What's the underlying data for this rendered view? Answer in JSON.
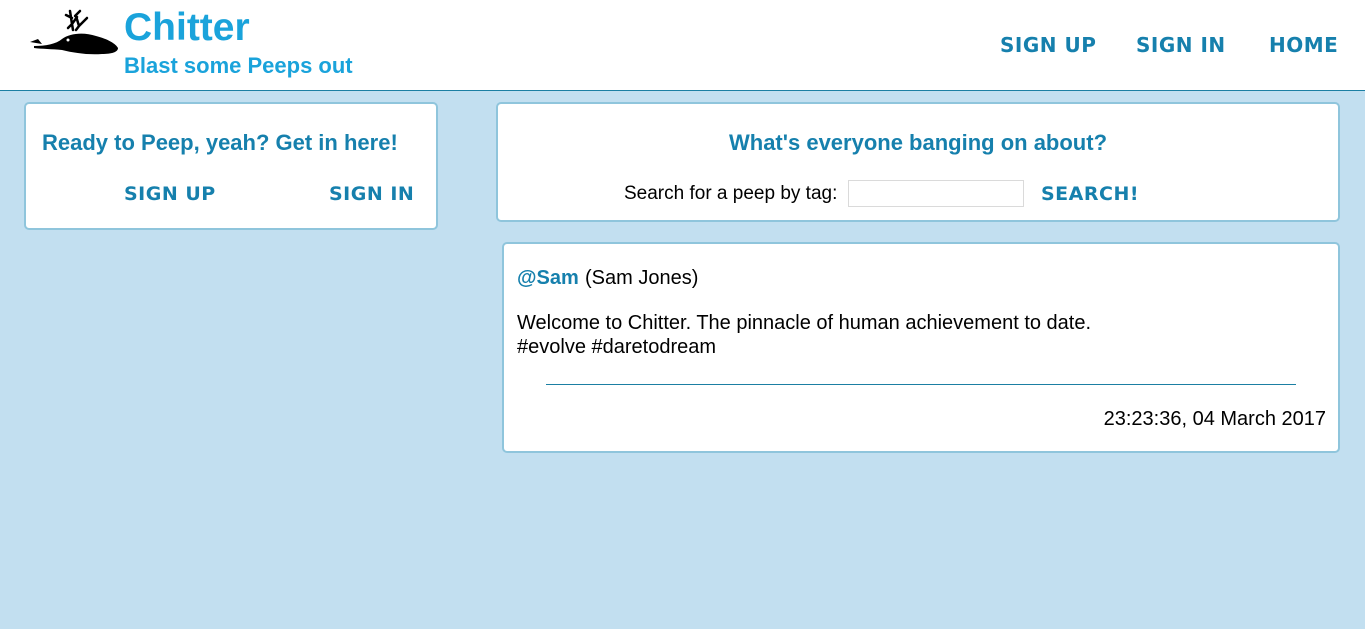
{
  "header": {
    "logo_icon": "dead-bird-icon",
    "title": "Chitter",
    "tagline": "Blast some Peeps out",
    "nav": {
      "sign_up": "SIGN UP",
      "sign_in": "SIGN IN",
      "home": "HOME"
    }
  },
  "welcome_panel": {
    "heading": "Ready to Peep, yeah? Get in here!",
    "sign_up": "SIGN UP",
    "sign_in": "SIGN IN"
  },
  "search_panel": {
    "heading": "What's everyone banging on about?",
    "label": "Search for a peep by tag:",
    "input_value": "",
    "button": "SEARCH!"
  },
  "peeps": [
    {
      "handle": "@Sam",
      "name": "(Sam Jones)",
      "message": "Welcome to Chitter. The pinnacle of human achievement to date.",
      "tags": "#evolve #daretodream",
      "timestamp": "23:23:36, 04 March 2017"
    }
  ],
  "colors": {
    "background": "#c2dff0",
    "brand": "#1aa3db",
    "link": "#1680ad",
    "panel_border": "#8fc5dc"
  }
}
